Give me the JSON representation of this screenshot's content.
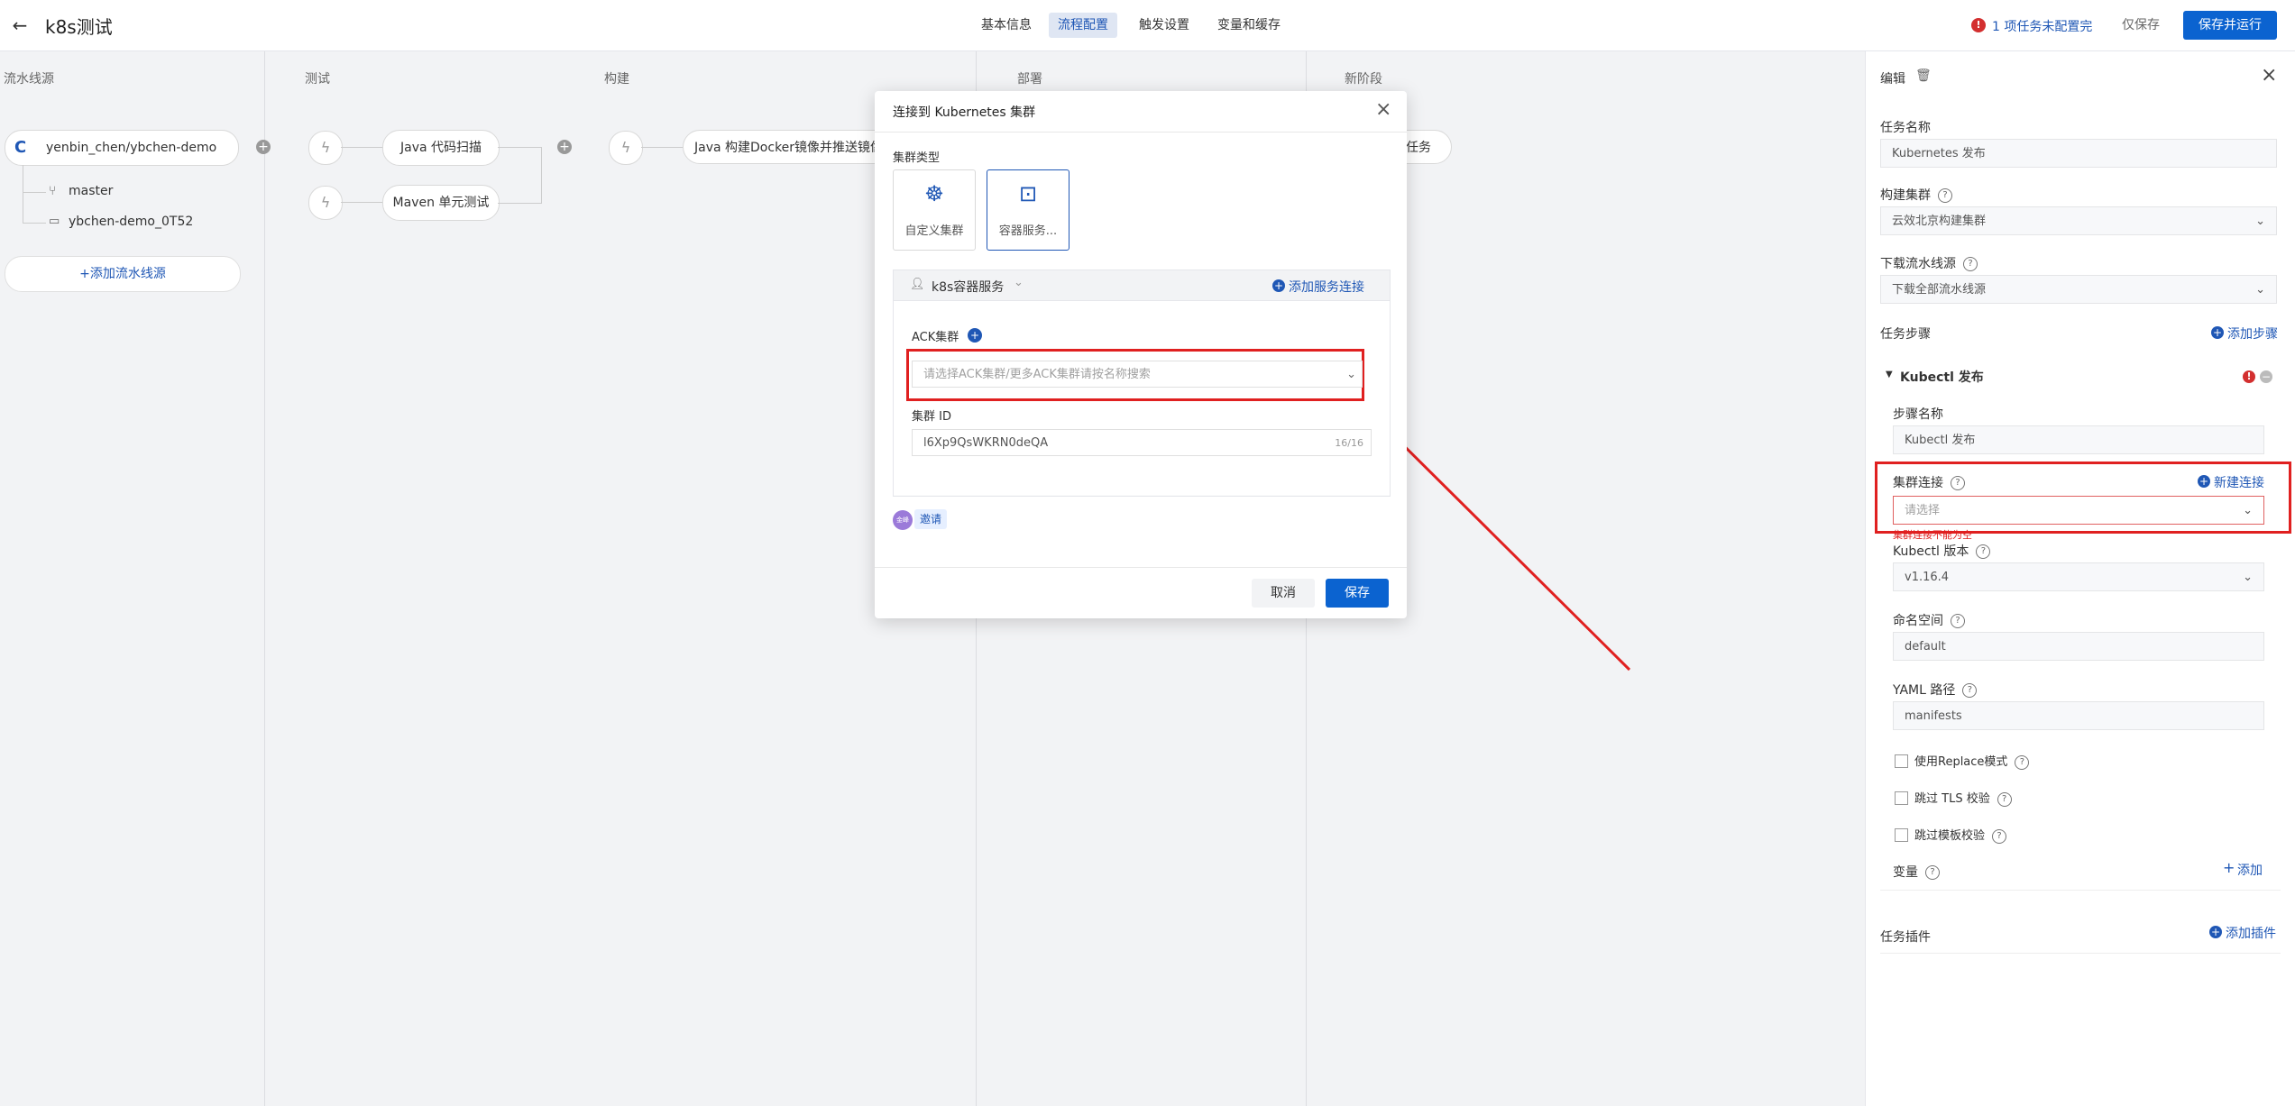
{
  "header": {
    "title": "k8s测试",
    "tabs": [
      {
        "label": "基本信息"
      },
      {
        "label": "流程配置"
      },
      {
        "label": "触发设置"
      },
      {
        "label": "变量和缓存"
      }
    ],
    "warning_count": "!",
    "warning_text": "1 项任务未配置完",
    "save_only": "仅保存",
    "save_run": "保存并运行"
  },
  "stages": {
    "source": "流水线源",
    "test": "测试",
    "build": "构建",
    "deploy": "部署",
    "new": "新阶段"
  },
  "pipeline": {
    "repo": "yenbin_chen/ybchen-demo",
    "branch": "master",
    "workspace": "ybchen-demo_0T52",
    "add_source": "+添加流水线源",
    "java_scan": "Java 代码扫描",
    "maven_test": "Maven 单元测试",
    "java_build": "Java 构建Docker镜像并推送镜像",
    "new_task_tail": "任务"
  },
  "modal": {
    "title": "连接到 Kubernetes 集群",
    "cluster_type_label": "集群类型",
    "type_custom": "自定义集群",
    "type_container": "容器服务...",
    "service_name": "k8s容器服务",
    "add_service": "添加服务连接",
    "ack_label": "ACK集群",
    "ack_placeholder": "请选择ACK集群/更多ACK集群请按名称搜索",
    "cluster_id_label": "集群 ID",
    "cluster_id_value": "l6Xp9QsWKRN0deQA",
    "cluster_id_count": "16/16",
    "invite_avatar": "金峰",
    "invite": "邀请",
    "cancel": "取消",
    "save": "保存"
  },
  "panel": {
    "edit": "编辑",
    "task_name_label": "任务名称",
    "task_name_value": "Kubernetes 发布",
    "build_cluster_label": "构建集群",
    "build_cluster_value": "云效北京构建集群",
    "download_label": "下载流水线源",
    "download_value": "下载全部流水线源",
    "steps_label": "任务步骤",
    "add_step": "添加步骤",
    "step_group": "Kubectl 发布",
    "step_name_label": "步骤名称",
    "step_name_value": "Kubectl 发布",
    "cluster_conn_label": "集群连接",
    "new_conn": "新建连接",
    "cluster_conn_placeholder": "请选择",
    "cluster_conn_error": "集群连接不能为空",
    "kubectl_version_label": "Kubectl 版本",
    "kubectl_version_value": "v1.16.4",
    "namespace_label": "命名空间",
    "namespace_value": "default",
    "yaml_label": "YAML 路径",
    "yaml_value": "manifests",
    "opt_replace": "使用Replace模式",
    "opt_tls": "跳过 TLS 校验",
    "opt_template": "跳过模板校验",
    "vars_label": "变量",
    "add_var": "添加",
    "plugins_label": "任务插件",
    "add_plugin": "添加插件"
  },
  "colors": {
    "accent": "#1f57b5",
    "primary_button": "#0b63d0",
    "highlight_red": "#e02020"
  }
}
